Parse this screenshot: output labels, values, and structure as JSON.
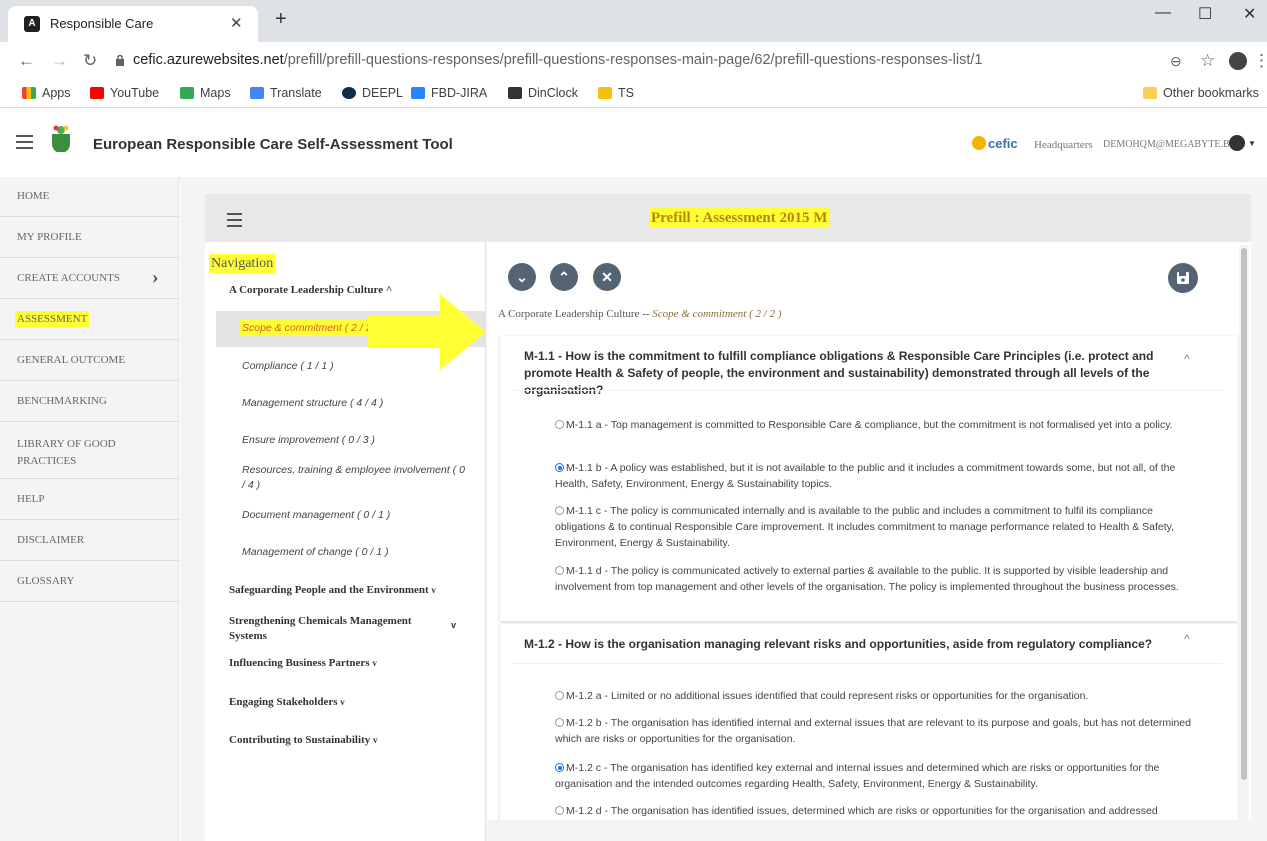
{
  "browser": {
    "tab_title": "Responsible Care",
    "url_host": "cefic.azurewebsites.net",
    "url_path": "/prefill/prefill-questions-responses/prefill-questions-responses-main-page/62/prefill-questions-responses-list/1",
    "bookmarks": [
      "Apps",
      "YouTube",
      "Maps",
      "Translate",
      "DEEPL",
      "FBD-JIRA",
      "DinClock",
      "TS"
    ],
    "other_bookmarks": "Other bookmarks"
  },
  "header": {
    "title": "European Responsible Care Self-Assessment Tool",
    "brand": "cefic",
    "org": "Headquarters",
    "user": "DEMOHQM@MEGABYTE.BE"
  },
  "sidebar": {
    "items": [
      {
        "label": "HOME"
      },
      {
        "label": "MY PROFILE"
      },
      {
        "label": "CREATE ACCOUNTS",
        "chevron": "›"
      },
      {
        "label": "ASSESSMENT"
      },
      {
        "label": "GENERAL OUTCOME"
      },
      {
        "label": "BENCHMARKING"
      },
      {
        "label": "LIBRARY OF GOOD PRACTICES"
      },
      {
        "label": "HELP"
      },
      {
        "label": "DISCLAIMER"
      },
      {
        "label": "GLOSSARY"
      }
    ]
  },
  "page": {
    "title": "Prefill : Assessment 2015 M"
  },
  "navigation": {
    "label": "Navigation",
    "sections": [
      {
        "label": "A Corporate Leadership Culture",
        "chevron": "^"
      },
      {
        "label": "Safeguarding People and the Environment",
        "chevron": "v"
      },
      {
        "label": "Strengthening Chemicals Management Systems",
        "chevron": "v"
      },
      {
        "label": "Influencing Business Partners",
        "chevron": "v"
      },
      {
        "label": "Engaging Stakeholders",
        "chevron": "v"
      },
      {
        "label": "Contributing to Sustainability",
        "chevron": "v"
      }
    ],
    "subitems": [
      {
        "label": "Scope & commitment ( 2 / 2 )"
      },
      {
        "label": "Compliance ( 1 / 1 )"
      },
      {
        "label": "Management structure ( 4 / 4 )"
      },
      {
        "label": "Ensure improvement ( 0 / 3 )"
      },
      {
        "label": "Resources, training & employee involvement ( 0 / 4 )"
      },
      {
        "label": "Document management ( 0 / 1 )"
      },
      {
        "label": "Management of change ( 0 / 1 )"
      }
    ]
  },
  "content": {
    "breadcrumb_section": "A Corporate Leadership Culture",
    "breadcrumb_sep": " -- ",
    "breadcrumb_sub": "Scope & commitment ( 2 / 2 )",
    "questions": [
      {
        "title": "M-1.1 - How is the commitment to fulfill compliance obligations & Responsible Care Principles (i.e. protect and promote Health & Safety of people, the environment and sustainability) demonstrated through all levels of the organisation?",
        "options": [
          {
            "code": "M-1.1 a",
            "text": "Top management is committed to Responsible Care & compliance, but the commitment is not formalised yet into a policy.",
            "selected": false
          },
          {
            "code": "M-1.1 b",
            "text": "A policy was established, but it is not available to the public and it includes a commitment towards some, but not all, of the Health, Safety, Environment, Energy & Sustainability topics.",
            "selected": true
          },
          {
            "code": "M-1.1 c",
            "text": "The policy is communicated internally and is available to the public and includes a commitment to fulfil its compliance obligations & to continual Responsible Care improvement. It includes commitment to manage performance related to Health & Safety, Environment, Energy & Sustainability.",
            "selected": false
          },
          {
            "code": "M-1.1 d",
            "text": "The policy is communicated actively to external parties & available to the public. It is supported by visible leadership and involvement from top management and other levels of the organisation. The policy is implemented throughout the business processes.",
            "selected": false
          }
        ]
      },
      {
        "title": "M-1.2 - How is the organisation managing relevant risks and opportunities, aside from regulatory compliance?",
        "options": [
          {
            "code": "M-1.2 a",
            "text": "Limited or no additional issues identified that could represent risks or opportunities for the organisation.",
            "selected": false
          },
          {
            "code": "M-1.2 b",
            "text": "The organisation has identified internal and external issues that are relevant to its purpose and goals, but has not determined which are risks or opportunities for the organisation.",
            "selected": false
          },
          {
            "code": "M-1.2 c",
            "text": "The organisation has identified key external and internal issues and determined which are risks or opportunities for the organisation and the intended outcomes regarding Health, Safety, Environment, Energy & Sustainability.",
            "selected": true
          },
          {
            "code": "M-1.2 d",
            "text": "The organisation has identified issues, determined which are risks or opportunities for the organisation and addressed",
            "selected": false
          }
        ]
      }
    ]
  }
}
